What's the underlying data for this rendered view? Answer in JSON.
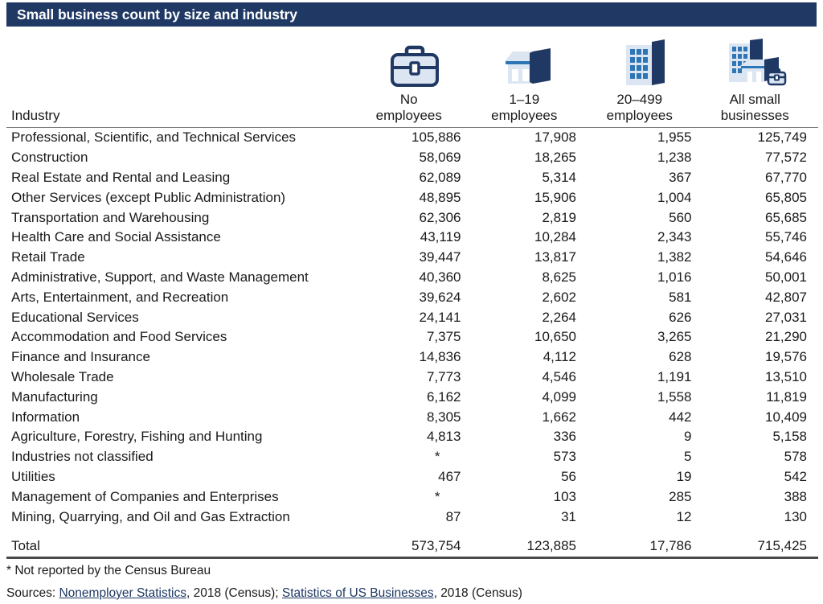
{
  "title": "Small business count by size and industry",
  "table": {
    "industry_header": "Industry",
    "columns": [
      {
        "icon": "briefcase-icon",
        "label": "No\nemployees"
      },
      {
        "icon": "storefront-icon",
        "label": "1–19\nemployees"
      },
      {
        "icon": "office-building-icon",
        "label": "20–499\nemployees"
      },
      {
        "icon": "all-businesses-icon",
        "label": "All small\nbusinesses"
      }
    ],
    "rows": [
      {
        "industry": "Professional, Scientific, and Technical Services",
        "no_employees": "105,886",
        "emp_1_19": "17,908",
        "emp_20_499": "1,955",
        "all_small": "125,749"
      },
      {
        "industry": "Construction",
        "no_employees": "58,069",
        "emp_1_19": "18,265",
        "emp_20_499": "1,238",
        "all_small": "77,572"
      },
      {
        "industry": "Real Estate and Rental and Leasing",
        "no_employees": "62,089",
        "emp_1_19": "5,314",
        "emp_20_499": "367",
        "all_small": "67,770"
      },
      {
        "industry": "Other Services (except Public Administration)",
        "no_employees": "48,895",
        "emp_1_19": "15,906",
        "emp_20_499": "1,004",
        "all_small": "65,805"
      },
      {
        "industry": "Transportation and Warehousing",
        "no_employees": "62,306",
        "emp_1_19": "2,819",
        "emp_20_499": "560",
        "all_small": "65,685"
      },
      {
        "industry": "Health Care and Social Assistance",
        "no_employees": "43,119",
        "emp_1_19": "10,284",
        "emp_20_499": "2,343",
        "all_small": "55,746"
      },
      {
        "industry": "Retail Trade",
        "no_employees": "39,447",
        "emp_1_19": "13,817",
        "emp_20_499": "1,382",
        "all_small": "54,646"
      },
      {
        "industry": "Administrative, Support, and Waste Management",
        "no_employees": "40,360",
        "emp_1_19": "8,625",
        "emp_20_499": "1,016",
        "all_small": "50,001"
      },
      {
        "industry": "Arts, Entertainment, and Recreation",
        "no_employees": "39,624",
        "emp_1_19": "2,602",
        "emp_20_499": "581",
        "all_small": "42,807"
      },
      {
        "industry": "Educational Services",
        "no_employees": "24,141",
        "emp_1_19": "2,264",
        "emp_20_499": "626",
        "all_small": "27,031"
      },
      {
        "industry": "Accommodation and Food Services",
        "no_employees": "7,375",
        "emp_1_19": "10,650",
        "emp_20_499": "3,265",
        "all_small": "21,290"
      },
      {
        "industry": "Finance and Insurance",
        "no_employees": "14,836",
        "emp_1_19": "4,112",
        "emp_20_499": "628",
        "all_small": "19,576"
      },
      {
        "industry": "Wholesale Trade",
        "no_employees": "7,773",
        "emp_1_19": "4,546",
        "emp_20_499": "1,191",
        "all_small": "13,510"
      },
      {
        "industry": "Manufacturing",
        "no_employees": "6,162",
        "emp_1_19": "4,099",
        "emp_20_499": "1,558",
        "all_small": "11,819"
      },
      {
        "industry": "Information",
        "no_employees": "8,305",
        "emp_1_19": "1,662",
        "emp_20_499": "442",
        "all_small": "10,409"
      },
      {
        "industry": "Agriculture, Forestry, Fishing and Hunting",
        "no_employees": "4,813",
        "emp_1_19": "336",
        "emp_20_499": "9",
        "all_small": "5,158"
      },
      {
        "industry": "Industries not classified",
        "no_employees": "*",
        "emp_1_19": "573",
        "emp_20_499": "5",
        "all_small": "578"
      },
      {
        "industry": "Utilities",
        "no_employees": "467",
        "emp_1_19": "56",
        "emp_20_499": "19",
        "all_small": "542"
      },
      {
        "industry": "Management of Companies and Enterprises",
        "no_employees": "*",
        "emp_1_19": "103",
        "emp_20_499": "285",
        "all_small": "388"
      },
      {
        "industry": "Mining, Quarrying, and Oil and Gas Extraction",
        "no_employees": "87",
        "emp_1_19": "31",
        "emp_20_499": "12",
        "all_small": "130"
      }
    ],
    "total_row": {
      "industry": "Total",
      "no_employees": "573,754",
      "emp_1_19": "123,885",
      "emp_20_499": "17,786",
      "all_small": "715,425"
    }
  },
  "footnotes": {
    "asterisk_note": "* Not reported by the Census Bureau",
    "sources_prefix": "Sources: ",
    "source_link_1": "Nonemployer Statistics",
    "sources_middle": ", 2018 (Census); ",
    "source_link_2": "Statistics of US Businesses",
    "sources_suffix": ", 2018 (Census)"
  },
  "colors": {
    "title_bar": "#1f3864",
    "icon_dark": "#1f3864",
    "icon_light": "#dce6f2",
    "icon_mid": "#2e75b6",
    "link": "#1f3864"
  }
}
